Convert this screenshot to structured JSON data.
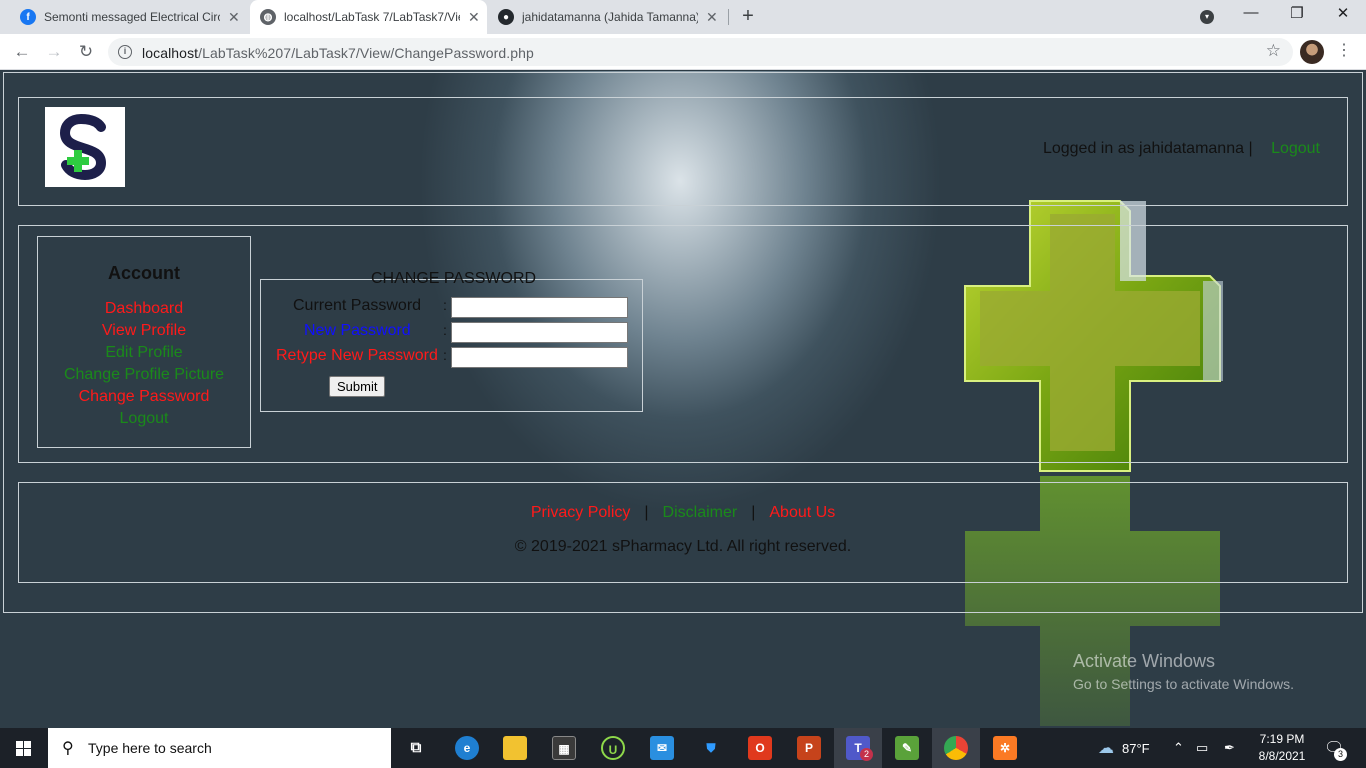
{
  "browser": {
    "tabs": [
      {
        "title": "Semonti messaged Electrical Circ",
        "active": false,
        "favicon": "facebook-icon"
      },
      {
        "title": "localhost/LabTask 7/LabTask7/Vie",
        "active": true,
        "favicon": "globe-icon"
      },
      {
        "title": "jahidatamanna (Jahida Tamanna)",
        "active": false,
        "favicon": "github-icon"
      }
    ],
    "url_host": "localhost",
    "url_path": "/LabTask%207/LabTask7/View/ChangePassword.php"
  },
  "header": {
    "logged_in_text": "Logged in as jahidatamanna |",
    "logout_label": "Logout"
  },
  "sidebar": {
    "title": "Account",
    "items": [
      {
        "label": "Dashboard",
        "color": "#ff1a1a"
      },
      {
        "label": "View Profile",
        "color": "#ff1a1a"
      },
      {
        "label": "Edit Profile",
        "color": "#1a8a1a"
      },
      {
        "label": "Change Profile Picture",
        "color": "#1a8a1a"
      },
      {
        "label": "Change Password",
        "color": "#ff1a1a"
      },
      {
        "label": "Logout",
        "color": "#1a8a1a"
      }
    ]
  },
  "form": {
    "legend": "CHANGE PASSWORD",
    "fields": [
      {
        "label": "Current Password",
        "value": ""
      },
      {
        "label": "New Password",
        "value": ""
      },
      {
        "label": "Retype New Password",
        "value": ""
      }
    ],
    "colon": ":",
    "submit_label": "Submit"
  },
  "footer": {
    "links": [
      "Privacy Policy",
      "Disclaimer",
      "About Us"
    ],
    "separator": "|",
    "copyright": "© 2019-2021 sPharmacy Ltd. All right reserved."
  },
  "watermark": {
    "line1": "Activate Windows",
    "line2": "Go to Settings to activate Windows."
  },
  "taskbar": {
    "search_placeholder": "Type here to search",
    "weather": "87°F",
    "time": "7:19 PM",
    "date": "8/8/2021",
    "notification_count": "3",
    "teams_badge": "2"
  },
  "colors": {
    "link_red": "#ff1a1a",
    "link_blue": "#1010ff",
    "link_green": "#1a8a1a"
  }
}
